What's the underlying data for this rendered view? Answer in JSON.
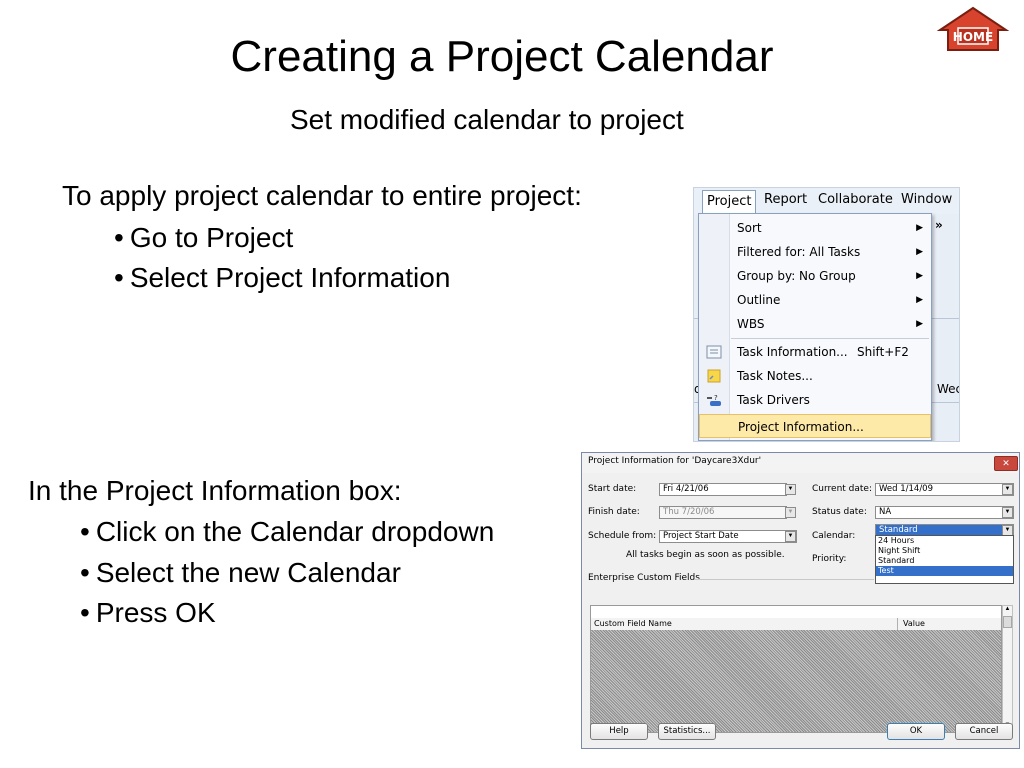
{
  "slide": {
    "title": "Creating a Project Calendar",
    "subtitle": "Set modified calendar to project",
    "section1": {
      "heading": "To apply project calendar to entire project:",
      "bullets": [
        "Go to Project",
        "Select Project Information"
      ]
    },
    "section2": {
      "heading": "In the Project Information box:",
      "bullets": [
        "Click on the Calendar dropdown",
        "Select the new Calendar",
        "Press OK"
      ]
    },
    "home_label": "HOME"
  },
  "menu_shot": {
    "menubar": {
      "project": "Project",
      "report": "Report",
      "collaborate": "Collaborate",
      "window": "Window"
    },
    "side_text": {
      "left": "d",
      "right": "Wec"
    },
    "items": [
      {
        "label": "Sort",
        "submenu": true
      },
      {
        "label": "Filtered for: All Tasks",
        "submenu": true
      },
      {
        "label": "Group by: No Group",
        "submenu": true
      },
      {
        "label": "Outline",
        "submenu": true
      },
      {
        "label": "WBS",
        "submenu": true
      },
      {
        "label": "Task Information...",
        "accel": "Shift+F2"
      },
      {
        "label": "Task Notes..."
      },
      {
        "label": "Task Drivers"
      },
      {
        "label": "Project Information..."
      }
    ]
  },
  "dialog": {
    "title": "Project Information for 'Daycare3Xdur'",
    "close": "✕",
    "start_date": {
      "label": "Start date:",
      "value": "Fri 4/21/06"
    },
    "finish_date": {
      "label": "Finish date:",
      "value": "Thu 7/20/06"
    },
    "schedule_from": {
      "label": "Schedule from:",
      "value": "Project Start Date"
    },
    "note": "All tasks begin as soon as possible.",
    "current_date": {
      "label": "Current date:",
      "value": "Wed 1/14/09"
    },
    "status_date": {
      "label": "Status date:",
      "value": "NA"
    },
    "calendar": {
      "label": "Calendar:",
      "value": "Standard",
      "options": [
        "24 Hours",
        "Night Shift",
        "Standard",
        "Test"
      ],
      "selected_index": 3
    },
    "priority": {
      "label": "Priority:"
    },
    "enterprise_fields": "Enterprise Custom Fields",
    "grid": {
      "col_name": "Custom Field Name",
      "col_value": "Value"
    },
    "buttons": {
      "help": "Help",
      "statistics": "Statistics...",
      "ok": "OK",
      "cancel": "Cancel"
    }
  }
}
